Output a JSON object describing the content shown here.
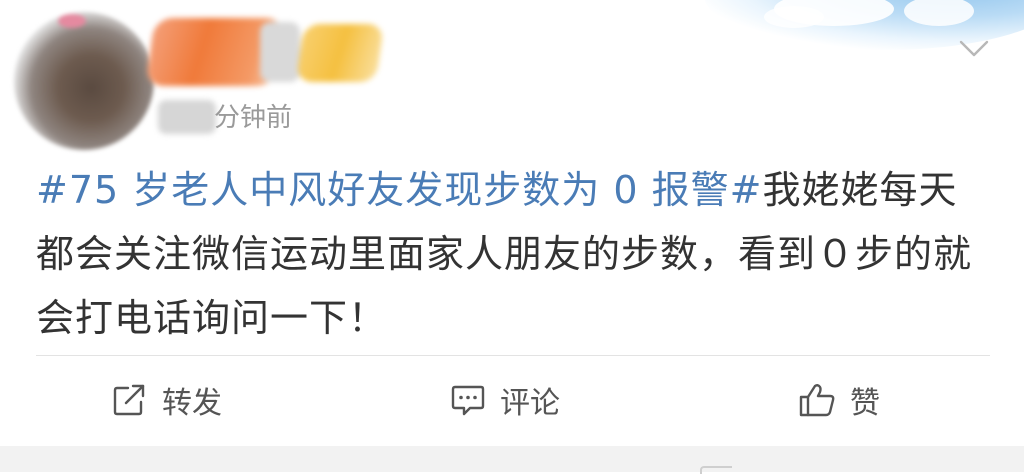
{
  "post": {
    "time_suffix": "分钟前",
    "body": {
      "hashtag": "#75 岁老人中风好友发现步数为 0 报警#",
      "text": "我姥姥每天都会关注微信运动里面家人朋友的步数，看到０步的就会打电话询问一下！"
    }
  },
  "actions": {
    "repost_label": "转发",
    "comment_label": "评论",
    "like_label": "赞"
  },
  "icons": {
    "menu": "chevron-down-icon",
    "repost": "share-square-icon",
    "comment": "comment-bubble-icon",
    "like": "thumbs-up-icon"
  },
  "colors": {
    "hashtag": "#4a7cb6",
    "text": "#333333",
    "muted": "#9a9a9a",
    "icon": "#555555"
  }
}
